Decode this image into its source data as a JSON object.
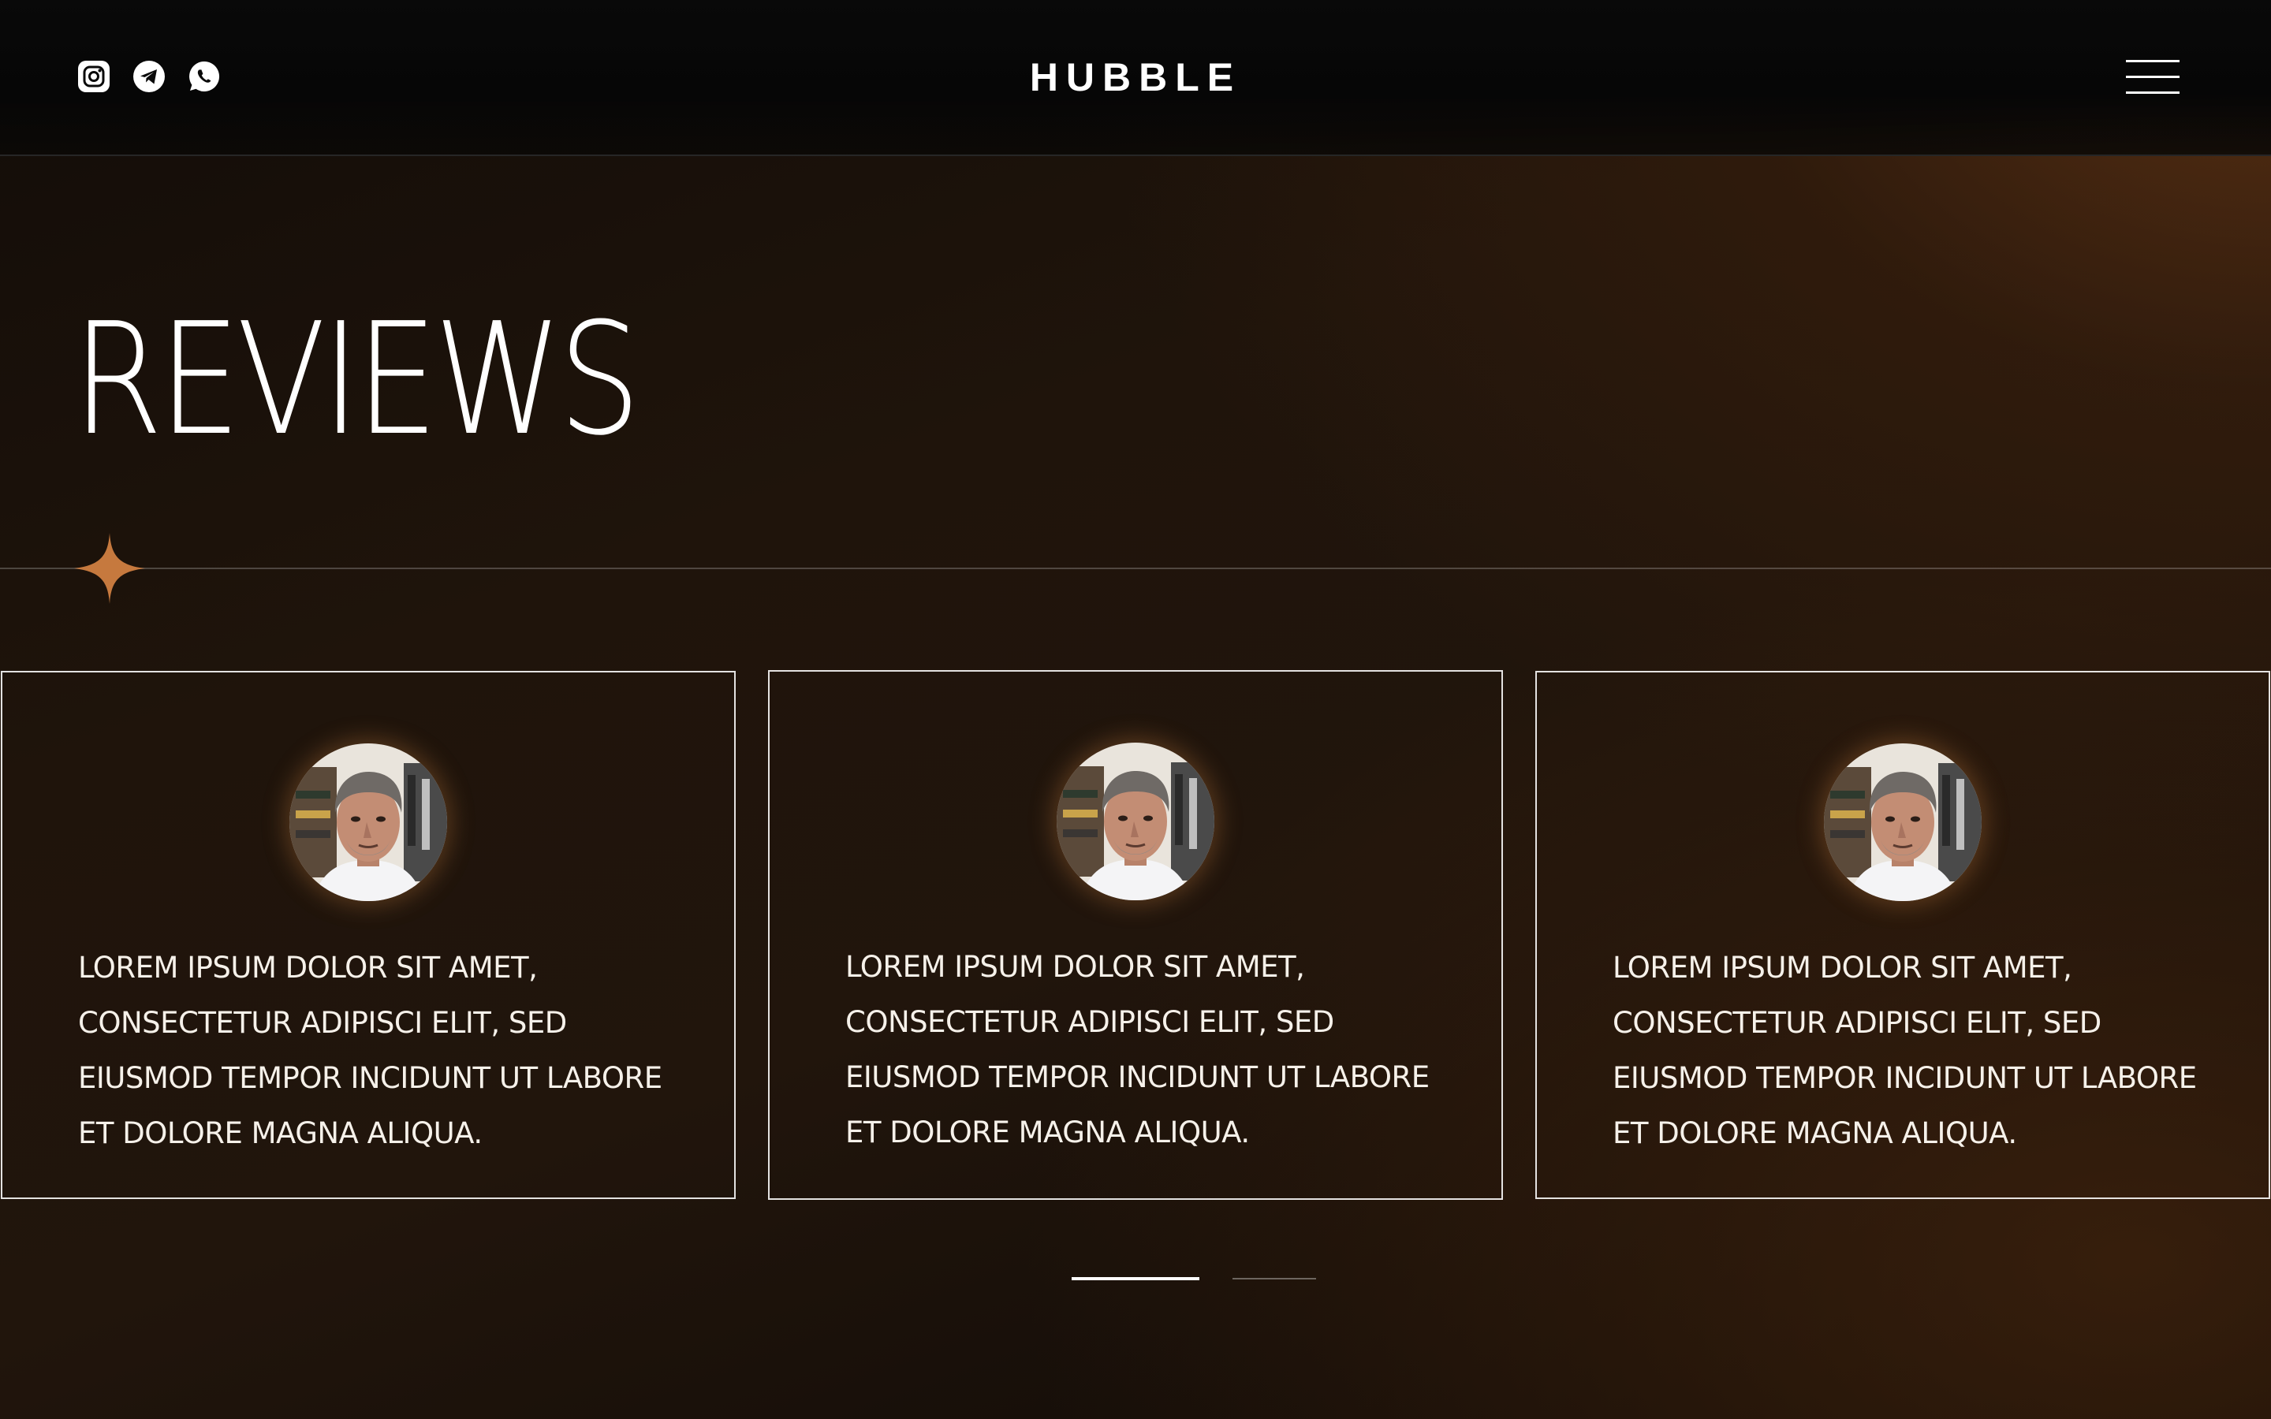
{
  "header": {
    "logo": "HUBBLE",
    "social_icons": [
      "instagram-icon",
      "telegram-icon",
      "whatsapp-icon"
    ],
    "menu_icon": "hamburger-menu-icon"
  },
  "section": {
    "title": "REVIEWS",
    "accent_color": "#c6793e"
  },
  "reviews": [
    {
      "text": "LOREM IPSUM DOLOR SIT AMET, CONSECTETUR ADIPISCI ELIT, SED EIUSMOD TEMPOR INCIDUNT UT LABORE ET DOLORE MAGNA ALIQUA.",
      "avatar": "reviewer-portrait"
    },
    {
      "text": "LOREM IPSUM DOLOR SIT AMET, CONSECTETUR ADIPISCI ELIT, SED EIUSMOD TEMPOR INCIDUNT UT LABORE ET DOLORE MAGNA ALIQUA.",
      "avatar": "reviewer-portrait"
    },
    {
      "text": "LOREM IPSUM DOLOR SIT AMET, CONSECTETUR ADIPISCI ELIT, SED EIUSMOD TEMPOR INCIDUNT UT LABORE ET DOLORE MAGNA ALIQUA.",
      "avatar": "reviewer-portrait"
    }
  ],
  "pager": {
    "pages": 2,
    "active_page": 1
  }
}
